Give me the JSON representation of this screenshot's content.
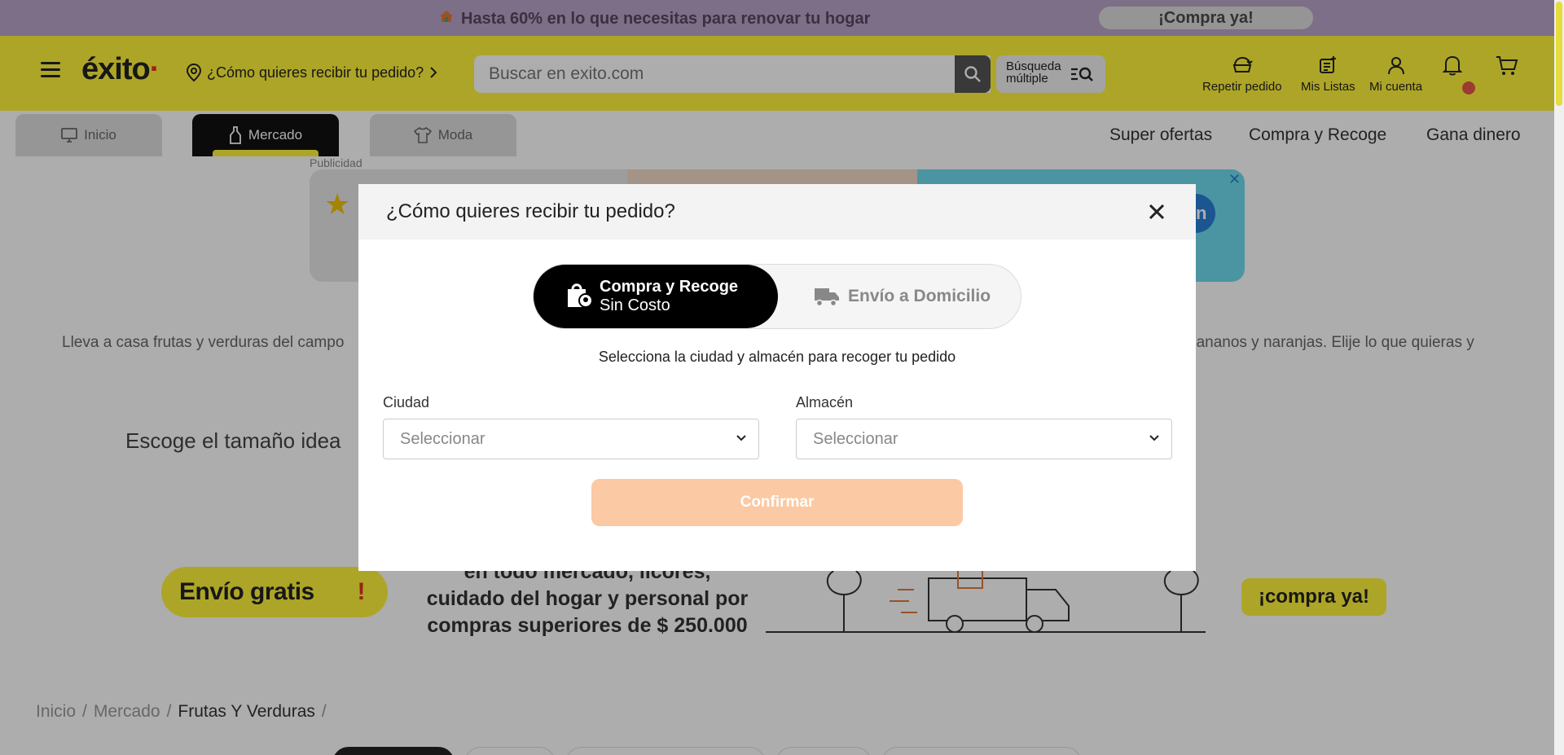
{
  "promo": {
    "message": "Hasta 60% en lo que necesitas para renovar tu hogar",
    "cta": "¡Compra ya!"
  },
  "header": {
    "logo": "éxito",
    "deliver_prompt": "¿Cómo quieres recibir tu pedido?",
    "search_placeholder": "Buscar en exito.com",
    "multi_search_line1": "Búsqueda",
    "multi_search_line2": "múltiple",
    "actions": [
      {
        "label": "Repetir pedido"
      },
      {
        "label": "Mis Listas"
      },
      {
        "label": "Mi cuenta"
      }
    ]
  },
  "nav": {
    "tabs": [
      {
        "label": "Inicio"
      },
      {
        "label": "Mercado"
      },
      {
        "label": "Moda"
      }
    ],
    "links": [
      "Super ofertas",
      "Compra y Recoge",
      "Gana dinero"
    ]
  },
  "ad": {
    "label": "Publicidad",
    "badge": "Zn",
    "close": "✕"
  },
  "content": {
    "description_left": "Lleva a casa frutas y verduras del campo",
    "description_right": "bananos y naranjas. Elije lo que quieras y",
    "size_heading": "Escoge el tamaño idea"
  },
  "shipping_banner": {
    "free": "Envío gratis",
    "bang": "!",
    "line1": "en todo mercado, licores,",
    "line2": "cuidado del hogar y personal por",
    "line3": "compras superiores de $ 250.000",
    "cta": "¡compra ya!"
  },
  "breadcrumb": {
    "items": [
      "Inicio",
      "Mercado",
      "Frutas Y Verduras"
    ],
    "separator": "/"
  },
  "modal": {
    "title": "¿Cómo quieres recibir tu pedido?",
    "option_pickup_line1": "Compra y Recoge",
    "option_pickup_line2": "Sin Costo",
    "option_delivery": "Envío a Domicilio",
    "subtitle": "Selecciona la ciudad y almacén para recoger tu pedido",
    "city_label": "Ciudad",
    "city_value": "Seleccionar",
    "store_label": "Almacén",
    "store_value": "Seleccionar",
    "confirm": "Confirmar"
  },
  "colors": {
    "brand_yellow": "#fff33a",
    "promo_purple": "#b9a4c7",
    "confirm_disabled": "#fbc9a3"
  }
}
